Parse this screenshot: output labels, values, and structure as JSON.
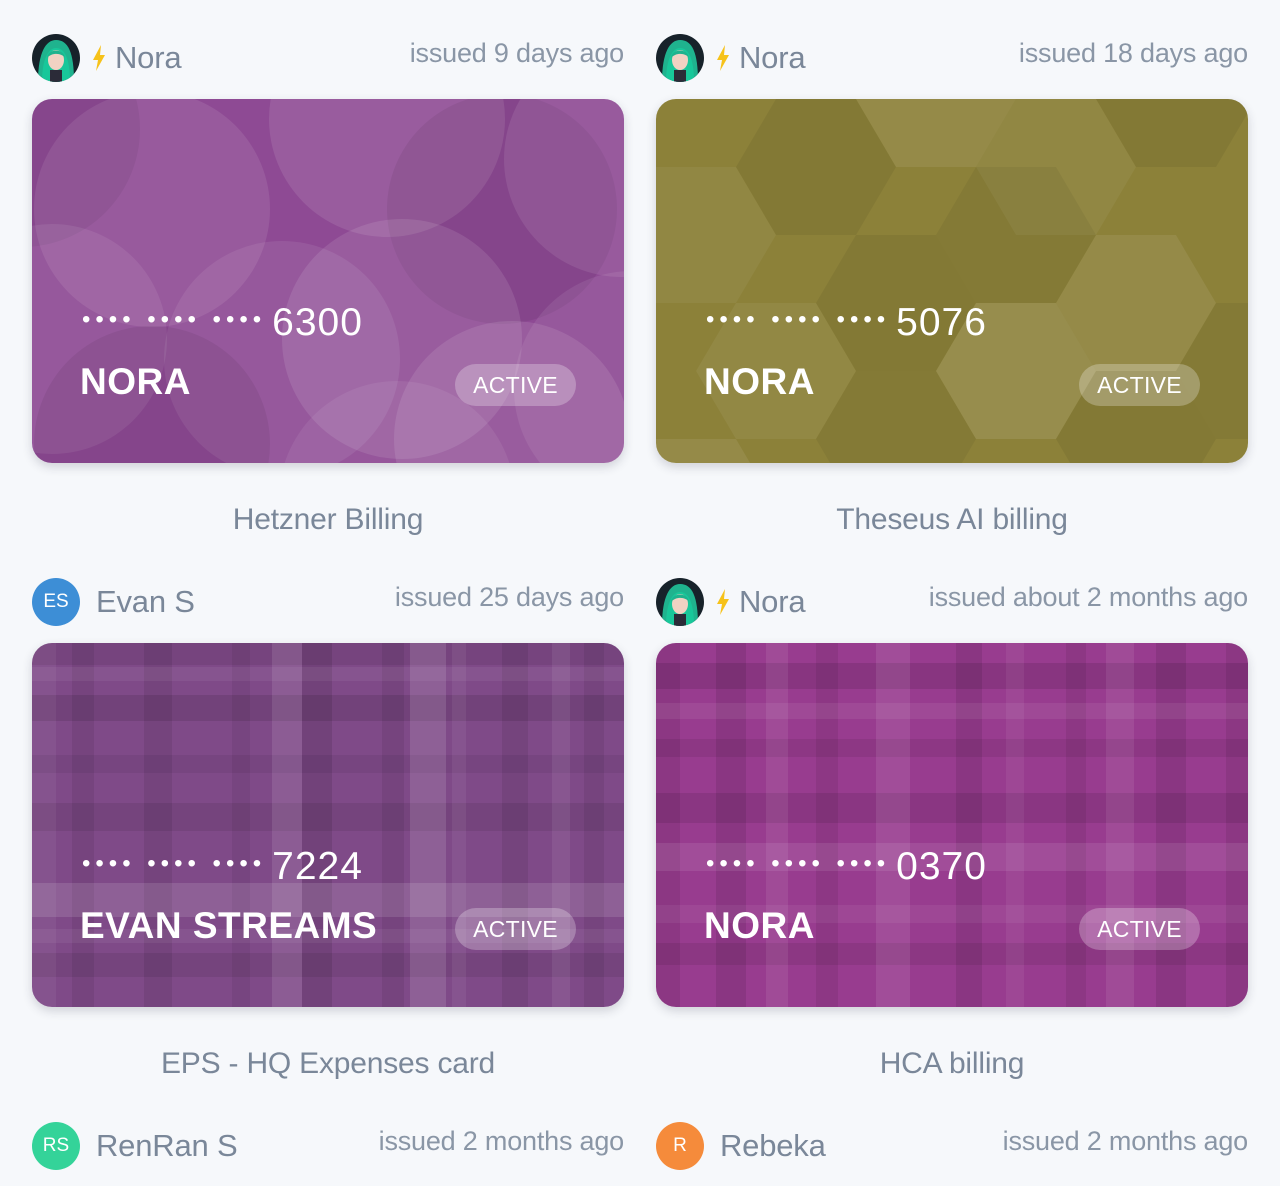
{
  "cards": [
    {
      "owner": "Nora",
      "avatar_type": "image",
      "has_bolt": true,
      "issued": "issued 9 days ago",
      "dots": "•••• •••• ••••",
      "last4": "6300",
      "holder": "NORA",
      "status": "ACTIVE",
      "caption": "Hetzner Billing",
      "color": "#8e4a94",
      "pattern": "circles"
    },
    {
      "owner": "Nora",
      "avatar_type": "image",
      "has_bolt": true,
      "issued": "issued 18 days ago",
      "dots": "•••• •••• ••••",
      "last4": "5076",
      "holder": "NORA",
      "status": "ACTIVE",
      "caption": "Theseus AI billing",
      "color": "#8c8139",
      "pattern": "hexagons"
    },
    {
      "owner": "Evan S",
      "avatar_type": "initials",
      "initials": "ES",
      "avatar_color": "#3d8ed6",
      "has_bolt": false,
      "issued": "issued 25 days ago",
      "dots": "•••• •••• ••••",
      "last4": "7224",
      "holder": "EVAN STREAMS",
      "status": "ACTIVE",
      "caption": "EPS - HQ Expenses card",
      "color": "#7f4a88",
      "pattern": "plaid"
    },
    {
      "owner": "Nora",
      "avatar_type": "image",
      "has_bolt": true,
      "issued": "issued about 2 months ago",
      "dots": "•••• •••• ••••",
      "last4": "0370",
      "holder": "NORA",
      "status": "ACTIVE",
      "caption": "HCA billing",
      "color": "#983c8f",
      "pattern": "plaid"
    }
  ],
  "footer_users": [
    {
      "owner": "RenRan S",
      "initials": "RS",
      "avatar_color": "#34d399",
      "issued": "issued 2 months ago"
    },
    {
      "owner": "Rebeka",
      "initials": "R",
      "avatar_color": "#f58b3b",
      "issued": "issued 2 months ago"
    }
  ]
}
